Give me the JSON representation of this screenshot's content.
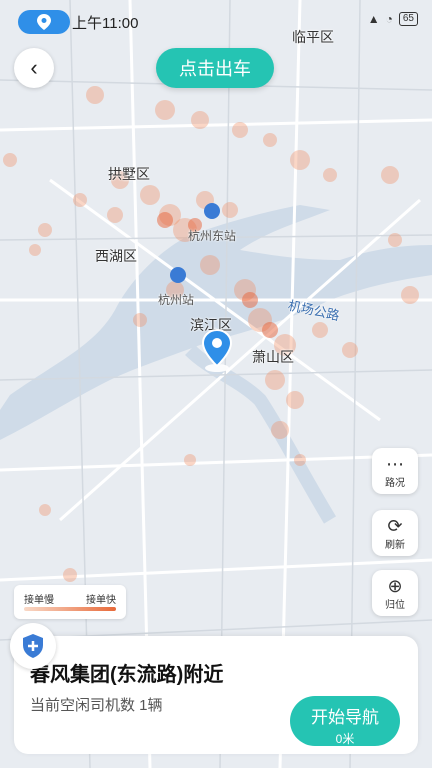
{
  "status": {
    "time": "上午11:00",
    "battery": "65"
  },
  "header": {
    "depart_label": "点击出车"
  },
  "map": {
    "labels": {
      "linping": "临平区",
      "gongshu": "拱墅区",
      "xihu": "西湖区",
      "hz_east": "杭州东站",
      "hz_station": "杭州站",
      "binjiang": "滨江区",
      "xiaoshan": "萧山区",
      "airport_road": "机场公路"
    }
  },
  "side_controls": {
    "traffic": "路况",
    "refresh": "刷新",
    "locate": "归位"
  },
  "legend": {
    "slow": "接单慢",
    "fast": "接单快"
  },
  "card": {
    "place": "春风集团(东流路)附近",
    "drivers": "当前空闲司机数 1辆",
    "nav_label": "开始导航",
    "nav_distance": "0米"
  }
}
